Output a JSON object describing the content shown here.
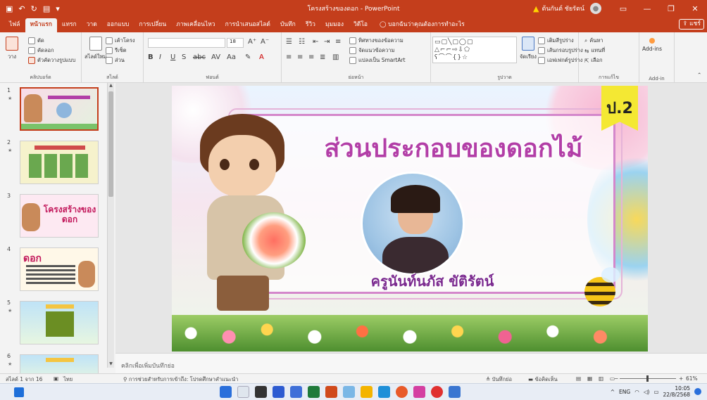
{
  "titlebar": {
    "qat": [
      "save-icon",
      "undo-icon",
      "redo-icon",
      "present-icon"
    ],
    "title": "โครงสร้างของดอก - PowerPoint",
    "warning_label": "ต้นกันต์ ชัยรัตน์",
    "avatar": "person-icon",
    "controls": [
      "ribbon-display-icon",
      "minimize-icon",
      "maximize-icon",
      "close-icon"
    ]
  },
  "menu": {
    "tabs": [
      "ไฟล์",
      "หน้าแรก",
      "แทรก",
      "วาด",
      "ออกแบบ",
      "การเปลี่ยน",
      "ภาพเคลื่อนไหว",
      "การนำเสนอสไลด์",
      "บันทึก",
      "รีวิว",
      "มุมมอง",
      "วิดีโอ"
    ],
    "active_index": 1,
    "tell_me": "บอกฉันว่าคุณต้องการทำอะไร",
    "share": "แชร์"
  },
  "ribbon": {
    "clipboard": {
      "paste": "วาง",
      "cut": "ตัด",
      "copy": "คัดลอก",
      "format_painter": "ตัวคัดวางรูปแบบ",
      "label": "คลิปบอร์ด"
    },
    "slides": {
      "new_slide": "สไลด์ใหม่",
      "layout": "เค้าโครง",
      "reset": "รีเซ็ต",
      "section": "ส่วน",
      "label": "สไลด์"
    },
    "font": {
      "font_name": "",
      "font_size": "18",
      "label": "ฟอนต์"
    },
    "paragraph": {
      "text_direction": "ทิศทางของข้อความ",
      "align_text": "จัดแนวข้อความ",
      "smartart": "แปลงเป็น SmartArt",
      "label": "ย่อหน้า"
    },
    "drawing": {
      "arrange": "จัดเรียง",
      "quick_styles": "สไตล์ด่วน",
      "shape_fill": "เติมสีรูปร่าง",
      "shape_outline": "เส้นกรอบรูปร่าง",
      "shape_effects": "เอฟเฟกต์รูปร่าง",
      "label": "รูปวาด"
    },
    "editing": {
      "find": "ค้นหา",
      "replace": "แทนที่",
      "select": "เลือก",
      "label": "การแก้ไข"
    },
    "addins": {
      "button": "Add-ins",
      "label": "Add-in"
    }
  },
  "thumbnails": [
    {
      "number": "1",
      "caption": ""
    },
    {
      "number": "2",
      "caption": ""
    },
    {
      "number": "3",
      "caption": "โครงสร้างของดอก"
    },
    {
      "number": "4",
      "caption": "ดอก"
    },
    {
      "number": "5",
      "caption": ""
    },
    {
      "number": "6",
      "caption": ""
    }
  ],
  "slide": {
    "title": "ส่วนประกอบของดอกไม้",
    "teacher": "ครูนันท์นภัส ขัติรัตน์",
    "grade_badge": "ป.2"
  },
  "notes_placeholder": "คลิกเพื่อเพิ่มบันทึกย่อ",
  "status": {
    "slide_info": "สไลด์ 1 จาก 16",
    "language": "ไทย",
    "accessibility": "การช่วยสำหรับการเข้าถึง: โปรดศึกษาคำแนะนำ",
    "notes": "บันทึกย่อ",
    "comments": "ข้อคิดเห็น",
    "zoom": "61%"
  },
  "taskbar": {
    "lang": "ENG",
    "time": "10:05",
    "date": "22/8/2568"
  },
  "colors": {
    "accent": "#c43e1c",
    "title_pink": "#b23ea7",
    "badge_yellow": "#f4e833"
  }
}
